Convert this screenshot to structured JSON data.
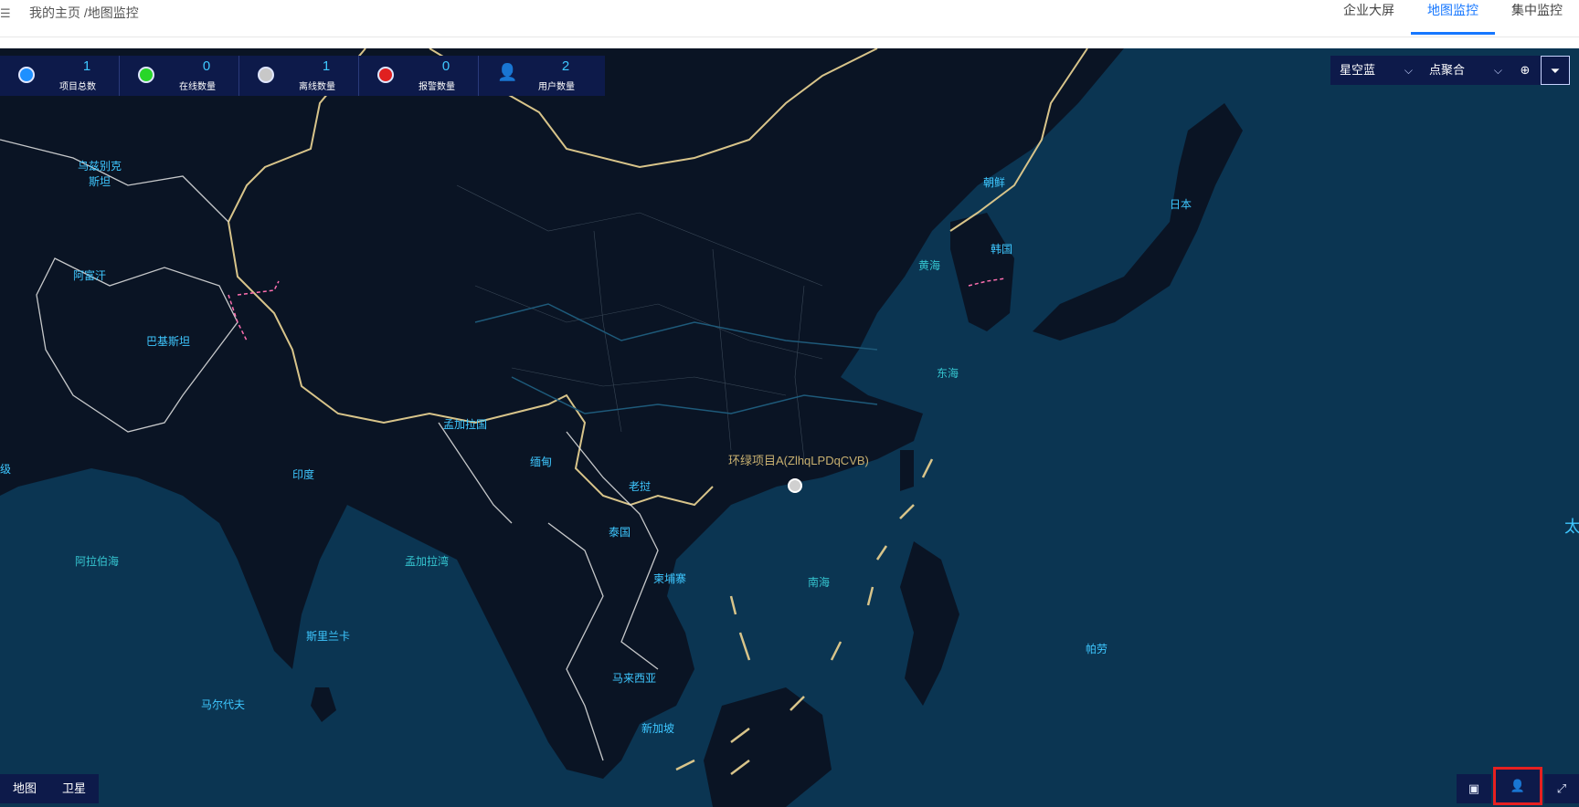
{
  "topbar": {
    "menu_icon": "menu-icon",
    "breadcrumb": "我的主页 /地图监控",
    "tabs": [
      {
        "label": "企业大屏",
        "active": false
      },
      {
        "label": "地图监控",
        "active": true
      },
      {
        "label": "集中监控",
        "active": false
      }
    ]
  },
  "stats": [
    {
      "value": "1",
      "label": "项目总数",
      "color": "#1e90ff"
    },
    {
      "value": "0",
      "label": "在线数量",
      "color": "#28d628"
    },
    {
      "value": "1",
      "label": "离线数量",
      "color": "#c8c8c8"
    },
    {
      "value": "0",
      "label": "报警数量",
      "color": "#e02020"
    },
    {
      "value": "2",
      "label": "用户数量",
      "color": "#3ec7ff",
      "icon": "user-icon"
    }
  ],
  "controls": {
    "theme_select": "星空蓝",
    "cluster_select": "点聚合",
    "locate_icon": "locate-icon",
    "filter_icon": "filter-icon"
  },
  "map_labels": {
    "uzbekistan": "乌兹别克\n斯坦",
    "afghanistan": "阿富汗",
    "pakistan": "巴基斯坦",
    "india": "印度",
    "bangladesh": "孟加拉国",
    "myanmar": "缅甸",
    "laos": "老挝",
    "thailand": "泰国",
    "cambodia": "柬埔寨",
    "malaysia": "马来西亚",
    "singapore": "新加坡",
    "sri_lanka": "斯里兰卡",
    "maldives": "马尔代夫",
    "north_korea": "朝鲜",
    "south_korea": "韩国",
    "japan": "日本",
    "palau": "帕劳",
    "yellow_sea": "黄海",
    "east_sea": "东海",
    "south_sea": "南海",
    "arabian_sea": "阿拉伯海",
    "bay_of_bengal": "孟加拉湾",
    "pacific_partial": "太",
    "left_partial": "级"
  },
  "marker": {
    "label": "环绿项目A(ZlhqLPDqCVB)"
  },
  "maptype": {
    "map": "地图",
    "satellite": "卫星"
  },
  "tools": {
    "building_icon": "building-icon",
    "user_icon": "user-icon",
    "fullscreen_icon": "fullscreen-icon"
  },
  "colors": {
    "accent": "#1677ff",
    "map_bg": "#0a1a2a",
    "panel": "#0d1a4a",
    "label": "#3ec7ff",
    "border_line": "#d8c48a",
    "highlight": "#e62020"
  }
}
